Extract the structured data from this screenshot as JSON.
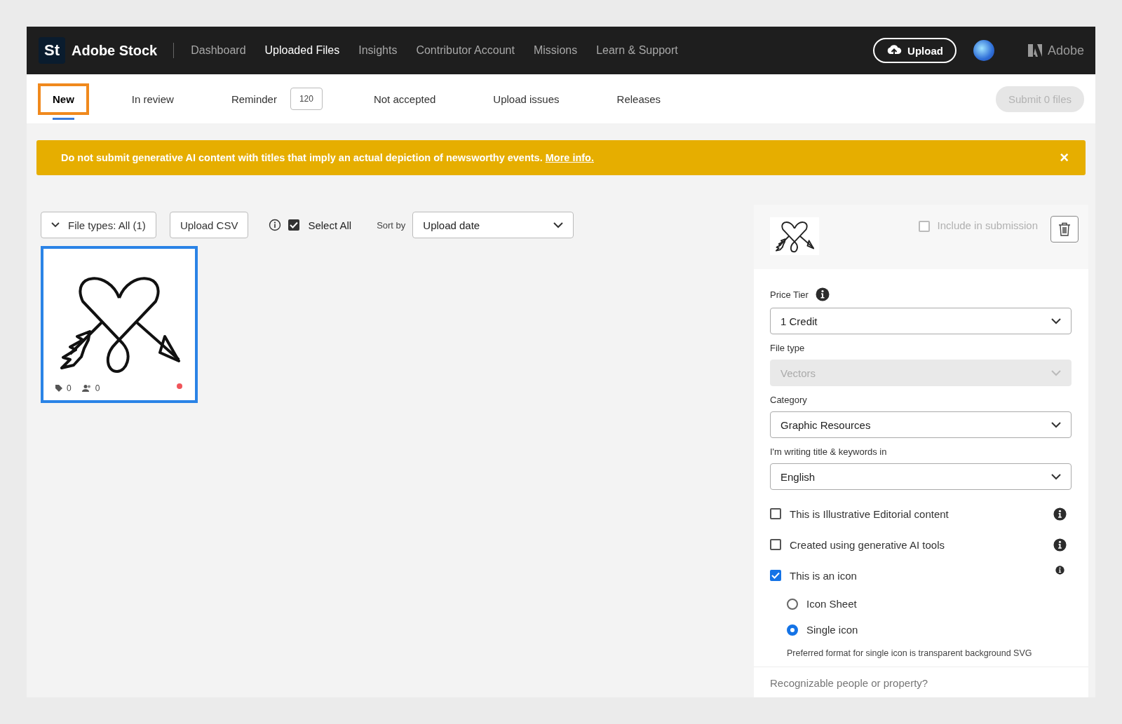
{
  "header": {
    "logo": "St",
    "brand": "Adobe Stock",
    "nav": [
      {
        "label": "Dashboard",
        "selected": false
      },
      {
        "label": "Uploaded Files",
        "selected": true
      },
      {
        "label": "Insights",
        "selected": false
      },
      {
        "label": "Contributor Account",
        "selected": false
      },
      {
        "label": "Missions",
        "selected": false
      },
      {
        "label": "Learn & Support",
        "selected": false
      }
    ],
    "upload_button": "Upload",
    "adobe": "Adobe"
  },
  "tabs": [
    {
      "label": "New",
      "selected": true
    },
    {
      "label": "In review",
      "selected": false
    },
    {
      "label": "Reminder",
      "selected": false,
      "badge": "120"
    },
    {
      "label": "Not accepted",
      "selected": false
    },
    {
      "label": "Upload issues",
      "selected": false
    },
    {
      "label": "Releases",
      "selected": false
    }
  ],
  "submit_button": {
    "label": "Submit 0 files",
    "disabled": true
  },
  "banner": {
    "text": "Do not submit generative AI content with titles that imply an actual depiction of newsworthy events.",
    "link": "More info.",
    "close": "×"
  },
  "toolbar": {
    "filter": "File types: All (1)",
    "upload_csv": "Upload CSV",
    "select_all": {
      "label": "Select All",
      "checked": true
    },
    "sort_label": "Sort by",
    "sort_value": "Upload date"
  },
  "files": [
    {
      "selected": true,
      "keywords": "0",
      "people": "0"
    }
  ],
  "panel": {
    "include": {
      "label": "Include in submission",
      "checked": false
    },
    "fields": [
      {
        "label": "Price Tier",
        "info": true,
        "value": "1 Credit",
        "disabled": false
      },
      {
        "label": "File type",
        "info": false,
        "value": "Vectors",
        "disabled": true
      },
      {
        "label": "Category",
        "info": false,
        "value": "Graphic Resources",
        "disabled": false
      },
      {
        "label": "I'm writing title & keywords in",
        "info": false,
        "value": "English",
        "disabled": false
      }
    ],
    "checkboxes": [
      {
        "label": "This is Illustrative Editorial content",
        "checked": false
      },
      {
        "label": "Created using generative AI tools",
        "checked": false
      },
      {
        "label": "This is an icon",
        "checked": true
      }
    ],
    "icon_options": [
      {
        "label": "Icon Sheet",
        "selected": false
      },
      {
        "label": "Single icon",
        "selected": true
      }
    ],
    "note": "Preferred format for single icon is transparent background SVG",
    "next_section": "Recognizable people or property?"
  }
}
